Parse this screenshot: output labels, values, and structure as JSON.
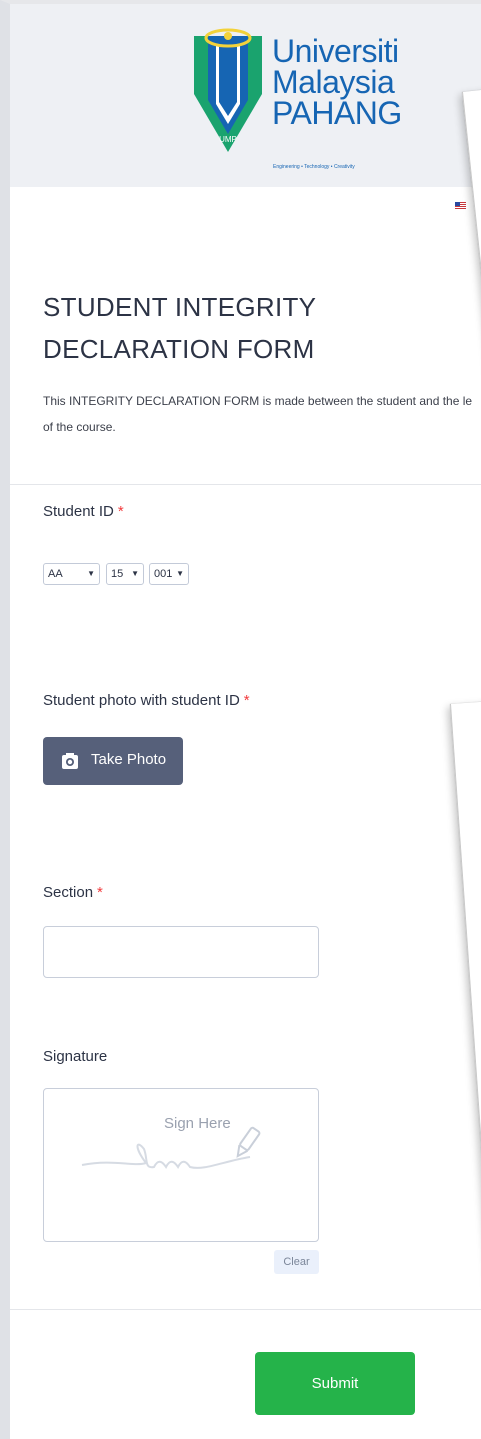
{
  "header": {
    "logo_line1": "Universiti",
    "logo_line2": "Malaysia",
    "logo_line3": "PAHANG",
    "logo_badge": "UMP",
    "logo_tagline": "Engineering • Technology • Creativity"
  },
  "form": {
    "title": "STUDENT INTEGRITY DECLARATION FORM",
    "description_line1": "This INTEGRITY DECLARATION FORM is made between the student and the le",
    "description_line2": "of the course."
  },
  "student_id": {
    "label": "Student ID",
    "required_mark": "*",
    "select_prefix": "AA",
    "select_year": "15",
    "select_number": "001"
  },
  "student_photo": {
    "label": "Student photo with student ID",
    "required_mark": "*",
    "button_label": "Take Photo",
    "icon": "camera-icon"
  },
  "section": {
    "label": "Section",
    "required_mark": "*",
    "value": ""
  },
  "signature": {
    "label": "Signature",
    "pad_text": "Sign Here",
    "clear_label": "Clear"
  },
  "submit_label": "Submit",
  "colors": {
    "header_bg": "#eef0f4",
    "logo_blue": "#1665b3",
    "logo_green": "#1aa36e",
    "button_dark": "#56607a",
    "submit_green": "#25b34a",
    "required_red": "#f23a3c"
  }
}
